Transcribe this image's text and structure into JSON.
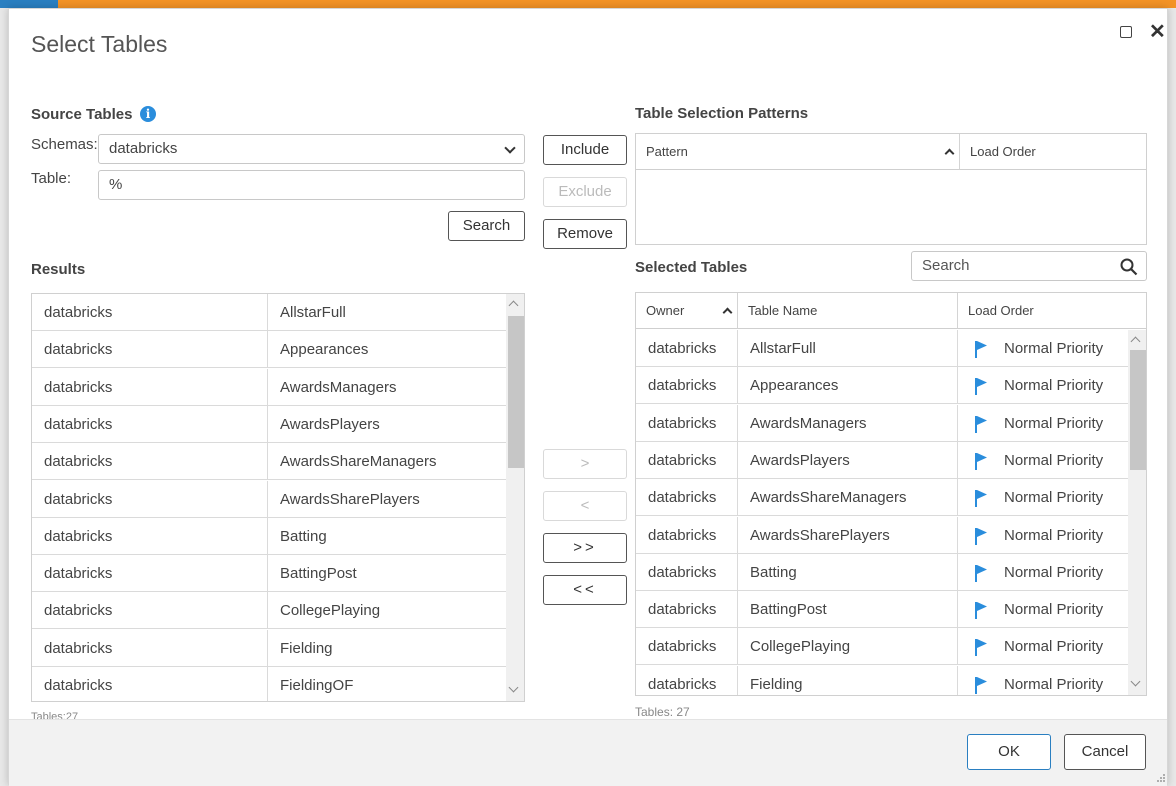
{
  "dialog": {
    "title": "Select Tables"
  },
  "source": {
    "heading": "Source Tables",
    "schemas_label": "Schemas:",
    "schema_value": "databricks",
    "table_label": "Table:",
    "table_value": "%",
    "search_label": "Search"
  },
  "actions": {
    "include": "Include",
    "exclude": "Exclude",
    "remove": "Remove",
    "move_right": ">",
    "move_left": "<",
    "move_all_right": ">>",
    "move_all_left": "<<"
  },
  "patterns": {
    "heading": "Table Selection Patterns",
    "col_pattern": "Pattern",
    "col_load_order": "Load Order"
  },
  "results": {
    "heading": "Results",
    "count": "Tables:27",
    "rows": [
      [
        "databricks",
        "AllstarFull"
      ],
      [
        "databricks",
        "Appearances"
      ],
      [
        "databricks",
        "AwardsManagers"
      ],
      [
        "databricks",
        "AwardsPlayers"
      ],
      [
        "databricks",
        "AwardsShareManagers"
      ],
      [
        "databricks",
        "AwardsSharePlayers"
      ],
      [
        "databricks",
        "Batting"
      ],
      [
        "databricks",
        "BattingPost"
      ],
      [
        "databricks",
        "CollegePlaying"
      ],
      [
        "databricks",
        "Fielding"
      ],
      [
        "databricks",
        "FieldingOF"
      ]
    ]
  },
  "selected": {
    "heading": "Selected Tables",
    "search_placeholder": "Search",
    "col_owner": "Owner",
    "col_table_name": "Table Name",
    "col_load_order": "Load Order",
    "count": "Tables: 27",
    "priority_color": "#2a8ddc",
    "rows": [
      [
        "databricks",
        "AllstarFull",
        "Normal Priority"
      ],
      [
        "databricks",
        "Appearances",
        "Normal Priority"
      ],
      [
        "databricks",
        "AwardsManagers",
        "Normal Priority"
      ],
      [
        "databricks",
        "AwardsPlayers",
        "Normal Priority"
      ],
      [
        "databricks",
        "AwardsShareManagers",
        "Normal Priority"
      ],
      [
        "databricks",
        "AwardsSharePlayers",
        "Normal Priority"
      ],
      [
        "databricks",
        "Batting",
        "Normal Priority"
      ],
      [
        "databricks",
        "BattingPost",
        "Normal Priority"
      ],
      [
        "databricks",
        "CollegePlaying",
        "Normal Priority"
      ],
      [
        "databricks",
        "Fielding",
        "Normal Priority"
      ]
    ]
  },
  "footer": {
    "ok": "OK",
    "cancel": "Cancel"
  }
}
